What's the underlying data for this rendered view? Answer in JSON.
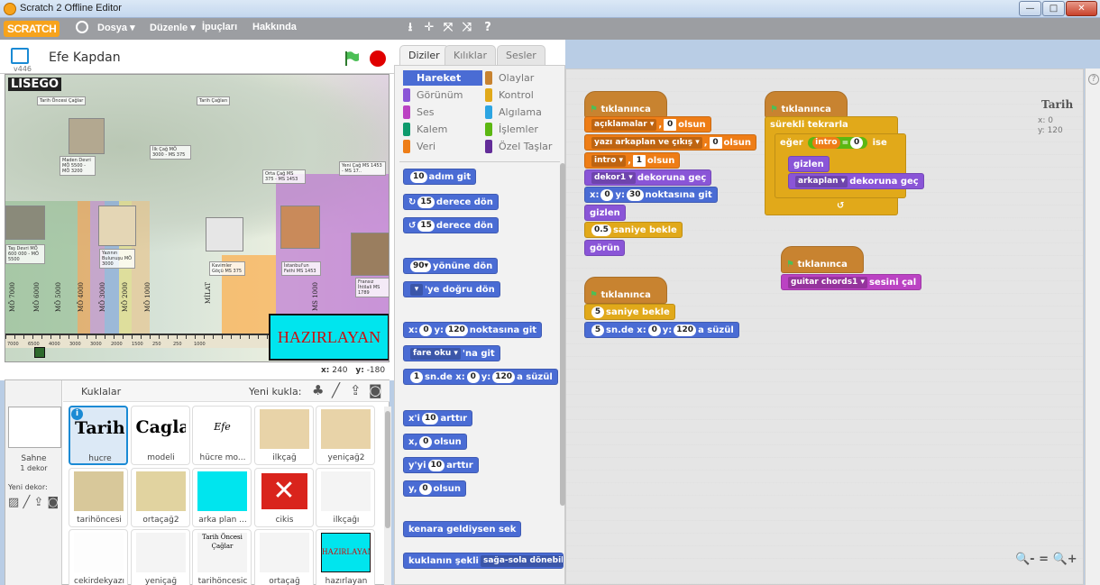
{
  "window": {
    "title": "Scratch 2 Offline Editor",
    "min": "—",
    "max": "□",
    "close": "✕"
  },
  "menu": {
    "logo": "SCRATCH",
    "file": "Dosya ▾",
    "edit": "Düzenle ▾",
    "tips": "İpuçları",
    "about": "Hakkında",
    "tools": [
      "⭳",
      "✛",
      "⤧",
      "⤨",
      "?"
    ]
  },
  "stage": {
    "version": "v446",
    "title": "Efe Kapdan",
    "brand": "LISEGO",
    "era_labels": [
      "Tarih Öncesi Çağlar",
      "Tarih Çağları",
      "Maden Devri MÖ 5500 - MÖ 3200",
      "İlk Çağ MÖ 3000 - MS 375",
      "Orta Çağ MS 375 - MS 1453",
      "Yeni Çağ MS 1453 - MS 17..",
      "Yazının Bulunuşu MÖ 3000",
      "Kavimler Göçü MS 375",
      "İstanbul'un Fethi MS 1453",
      "Fransız İhtilali MS 1789",
      "Taş Devri MÖ 600 000 - MÖ 5500"
    ],
    "year_labels": [
      "MÖ 7000",
      "MÖ 6000",
      "MÖ 5000",
      "MÖ 4000",
      "MÖ 3000",
      "MÖ 2000",
      "MÖ 1000",
      "MİLAT",
      "MS 1000"
    ],
    "ruler_labels": [
      "7000",
      "6500",
      "4000",
      "3000",
      "3000",
      "2000",
      "1500",
      "250",
      "250",
      "1000"
    ],
    "hazirlayan": "HAZIRLAYAN",
    "x_label": "x:",
    "x_value": "240",
    "y_label": "y:",
    "y_value": "-180"
  },
  "sprites_panel": {
    "title": "Kuklalar",
    "new_sprite": "Yeni kukla:",
    "stage_label": "Sahne",
    "stage_sub": "1 dekor",
    "new_bg": "Yeni dekor:",
    "sprites": [
      {
        "name": "hucre",
        "thumb": "Tarih"
      },
      {
        "name": "modeli",
        "thumb": "Caglari"
      },
      {
        "name": "hücre mo...",
        "thumb": "Efe Kapdan"
      },
      {
        "name": "ilkçağ",
        "thumb": ""
      },
      {
        "name": "yeniçağ2",
        "thumb": ""
      },
      {
        "name": "tarihöncesi",
        "thumb": ""
      },
      {
        "name": "ortaçağ2",
        "thumb": ""
      },
      {
        "name": "arka plan ...",
        "thumb": ""
      },
      {
        "name": "cikis",
        "thumb": ""
      },
      {
        "name": "ilkçağı",
        "thumb": ""
      },
      {
        "name": "cekirdekyazı",
        "thumb": ""
      },
      {
        "name": "yeniçağ",
        "thumb": ""
      },
      {
        "name": "tarihöncesic",
        "thumb": "Tarih Öncesi Çağlar"
      },
      {
        "name": "ortaçağ",
        "thumb": ""
      },
      {
        "name": "hazırlayan",
        "thumb": "HAZIRLAYAN"
      }
    ]
  },
  "tabs": [
    "Diziler",
    "Kılıklar",
    "Sesler"
  ],
  "categories": [
    {
      "label": "Hareket",
      "color": "#4a6cd4"
    },
    {
      "label": "Olaylar",
      "color": "#c88330"
    },
    {
      "label": "Görünüm",
      "color": "#8a55d7"
    },
    {
      "label": "Kontrol",
      "color": "#e1a91a"
    },
    {
      "label": "Ses",
      "color": "#bb42c3"
    },
    {
      "label": "Algılama",
      "color": "#2ca5e2"
    },
    {
      "label": "Kalem",
      "color": "#0e9a6c"
    },
    {
      "label": "İşlemler",
      "color": "#5cb712"
    },
    {
      "label": "Veri",
      "color": "#ee7d16"
    },
    {
      "label": "Özel Taşlar",
      "color": "#632d99"
    }
  ],
  "palette": {
    "move": {
      "v": "10",
      "t": "adım git"
    },
    "turn_right": {
      "v": "15",
      "t": "derece dön"
    },
    "turn_left": {
      "v": "15",
      "t": "derece dön"
    },
    "point_dir": {
      "v": "90▾",
      "t": "yönüne dön"
    },
    "point_to": {
      "v": "▾",
      "t": "'ye doğru dön"
    },
    "goto_xy": {
      "a": "x:",
      "x": "0",
      "b": "y:",
      "y": "120",
      "t": "noktasına git"
    },
    "goto": {
      "v": "fare oku ▾",
      "t": "'na git"
    },
    "glide": {
      "s": "1",
      "a": "sn.de x:",
      "x": "0",
      "b": "y:",
      "y": "120",
      "t": "a süzül"
    },
    "change_x": {
      "a": "x'i",
      "v": "10",
      "t": "arttır"
    },
    "set_x": {
      "a": "x,",
      "v": "0",
      "t": "olsun"
    },
    "change_y": {
      "a": "y'yi",
      "v": "10",
      "t": "arttır"
    },
    "set_y": {
      "a": "y,",
      "v": "0",
      "t": "olsun"
    },
    "bounce": "kenara geldiysen sek",
    "rotation": {
      "a": "kuklanın şekli",
      "v": "sağa-sola dönebilsin"
    }
  },
  "scripts": {
    "sprite_name": "Tarih",
    "x": "x: 0",
    "y": "y: 120",
    "when_flag": "tıklanınca",
    "s1": {
      "b1": {
        "v": "açıklamalar ▾",
        "a": ",",
        "n": "0",
        "t": "olsun"
      },
      "b2": {
        "v": "yazı arkaplan ve çıkış ▾",
        "a": ",",
        "n": "0",
        "t": "olsun"
      },
      "b3": {
        "v": "intro ▾",
        "a": ",",
        "n": "1",
        "t": "olsun"
      },
      "b4": {
        "v": "dekor1 ▾",
        "t": "dekoruna geç"
      },
      "b5": {
        "a": "x:",
        "x": "0",
        "b": "y:",
        "y": "30",
        "t": "noktasına git"
      },
      "b6": "gizlen",
      "b7": {
        "v": "0.5",
        "t": "saniye bekle"
      },
      "b8": "görün"
    },
    "s2": {
      "forever": "sürekli tekrarla",
      "if": "eğer",
      "var": "intro",
      "eq": "=",
      "n": "0",
      "then": "ise",
      "hide": "gizlen",
      "sw": {
        "v": "arkaplan ▾",
        "t": "dekoruna geç"
      },
      "arrow": "↺"
    },
    "s3": {
      "wait": {
        "v": "5",
        "t": "saniye bekle"
      },
      "glide": {
        "s": "5",
        "a": "sn.de x:",
        "x": "0",
        "b": "y:",
        "y": "120",
        "t": "a süzül"
      }
    },
    "s4": {
      "v": "guitar chords1 ▾",
      "t": "sesini çal"
    },
    "zoom": [
      "🔍-",
      "=",
      "🔍+"
    ]
  }
}
